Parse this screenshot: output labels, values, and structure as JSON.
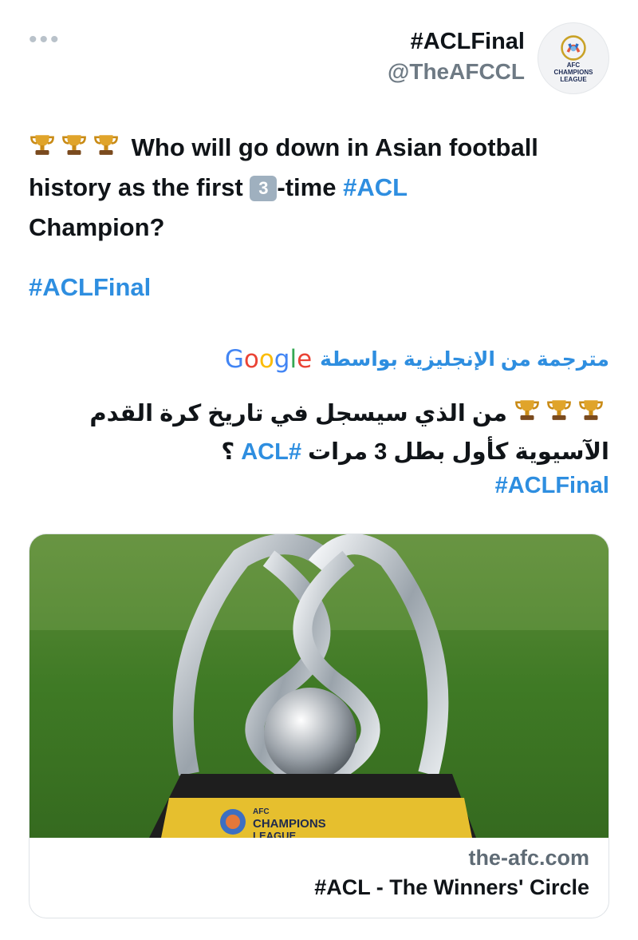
{
  "header": {
    "display_name": "#ACLFinal",
    "handle": "@TheAFCCL",
    "more_label": "•••",
    "avatar": {
      "icon": "afc-champions-league-logo",
      "text_lines": [
        "AFC",
        "CHAMPIONS",
        "LEAGUE"
      ]
    }
  },
  "tweet": {
    "trophy_icon": "trophy-emoji",
    "line1": "Who will go down in Asian football",
    "line2_pre": "history as the first",
    "number_badge": "3",
    "line2_post": "-time",
    "line2_hashtag": "#ACL",
    "line3": "Champion?",
    "hashtag": "#ACLFinal"
  },
  "translation": {
    "label": "مترجمة من الإنجليزية بواسطة",
    "provider_letters": [
      "G",
      "o",
      "o",
      "g",
      "l",
      "e"
    ],
    "line1": "من الذي سيسجل في تاريخ كرة القدم",
    "line2_pre": "الآسيوية كأول بطل 3 مرات",
    "line2_hashtag": "#ACL",
    "line2_post": "؟",
    "hashtag": "#ACLFinal"
  },
  "link_card": {
    "image_description": "acl-trophy-photo",
    "image_banner_lines": [
      "AFC",
      "CHAMPIONS",
      "LEAGUE"
    ],
    "domain": "the-afc.com",
    "title": "#ACL - The Winners' Circle"
  },
  "colors": {
    "accent": "#2e8ee0",
    "text": "#101418",
    "muted": "#6e7a84"
  }
}
